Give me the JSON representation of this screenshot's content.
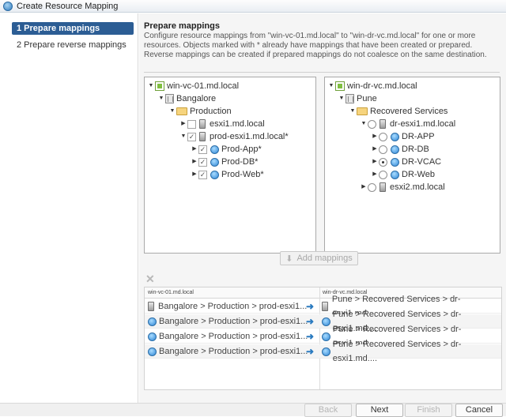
{
  "window": {
    "title": "Create Resource Mapping"
  },
  "steps": [
    {
      "label": "1  Prepare mappings",
      "active": true
    },
    {
      "label": "2  Prepare reverse mappings",
      "active": false
    }
  ],
  "main": {
    "heading": "Prepare mappings",
    "description": "Configure resource mappings from \"win-vc-01.md.local\" to \"win-dr-vc.md.local\" for one or more resources. Objects marked with * already have mappings that have been created or prepared. Reverse mappings can be created if prepared mappings do not coalesce on the same destination."
  },
  "source_tree": {
    "vcenter": "win-vc-01.md.local",
    "datacenter": "Bangalore",
    "folder": "Production",
    "host1": "esxi1.md.local",
    "host2": "prod-esxi1.md.local*",
    "pool1": "Prod-App*",
    "pool2": "Prod-DB*",
    "pool3": "Prod-Web*"
  },
  "target_tree": {
    "vcenter": "win-dr-vc.md.local",
    "datacenter": "Pune",
    "folder": "Recovered Services",
    "host1": "dr-esxi1.md.local",
    "pool1": "DR-APP",
    "pool2": "DR-DB",
    "pool3": "DR-VCAC",
    "pool4": "DR-Web",
    "host2": "esxi2.md.local"
  },
  "add_button": {
    "label": "Add mappings",
    "enabled": false
  },
  "grid": {
    "columns": [
      "win-vc-01.md.local",
      "win-dr-vc.md.local"
    ],
    "rows": [
      {
        "source": "Bangalore > Production > prod-esxi1...",
        "target": "Pune > Recovered Services > dr-esxi1.md...."
      },
      {
        "source": "Bangalore > Production > prod-esxi1...",
        "target": "Pune > Recovered Services > dr-esxi1.md...."
      },
      {
        "source": "Bangalore > Production > prod-esxi1...",
        "target": "Pune > Recovered Services > dr-esxi1.md...."
      },
      {
        "source": "Bangalore > Production > prod-esxi1...",
        "target": "Pune > Recovered Services > dr-esxi1.md...."
      }
    ]
  },
  "footer": {
    "back": "Back",
    "next": "Next",
    "finish": "Finish",
    "cancel": "Cancel"
  },
  "icons": {
    "vcenter": "vcenter-icon",
    "datacenter": "datacenter-icon",
    "folder": "folder-icon",
    "host": "host-icon",
    "resource_pool": "resource-pool-icon"
  },
  "colors": {
    "active_step_bg": "#2c5d94",
    "arrow": "#2b7bc0"
  }
}
